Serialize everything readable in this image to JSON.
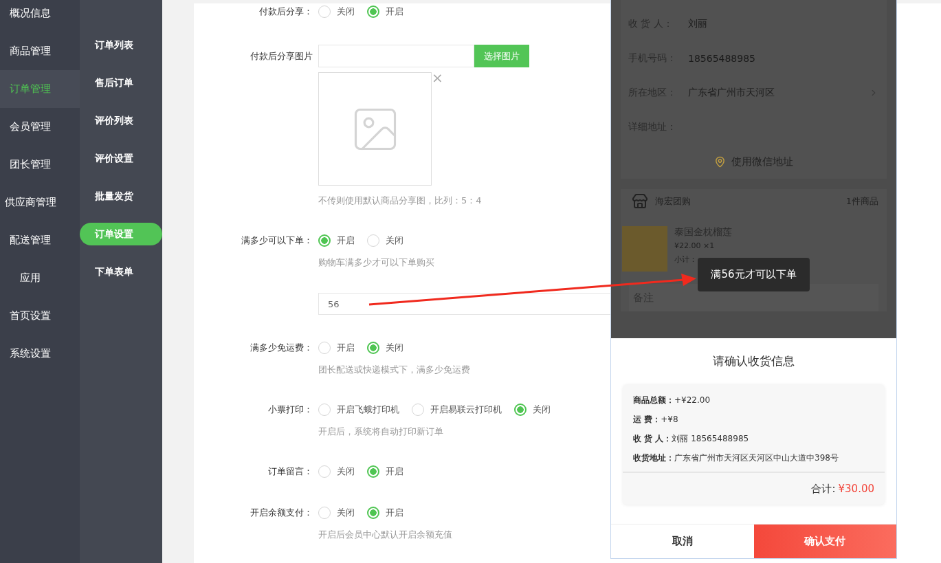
{
  "nav": {
    "items": [
      {
        "label": "概况信息",
        "selected": false
      },
      {
        "label": "商品管理",
        "selected": false
      },
      {
        "label": "订单管理",
        "selected": true
      },
      {
        "label": "会员管理",
        "selected": false
      },
      {
        "label": "团长管理",
        "selected": false
      },
      {
        "label": "供应商管理",
        "selected": false
      },
      {
        "label": "配送管理",
        "selected": false
      },
      {
        "label": "应用",
        "selected": false
      },
      {
        "label": "首页设置",
        "selected": false
      },
      {
        "label": "系统设置",
        "selected": false
      }
    ]
  },
  "subnav": {
    "items": [
      {
        "label": "订单列表",
        "selected": false
      },
      {
        "label": "售后订单",
        "selected": false
      },
      {
        "label": "评价列表",
        "selected": false
      },
      {
        "label": "评价设置",
        "selected": false
      },
      {
        "label": "批量发货",
        "selected": false
      },
      {
        "label": "订单设置",
        "selected": true
      },
      {
        "label": "下单表单",
        "selected": false
      }
    ]
  },
  "form": {
    "fields": [
      {
        "kind": "radio",
        "label": "付款后分享：",
        "options": [
          {
            "label": "关闭",
            "selected": false
          },
          {
            "label": "开启",
            "selected": true
          }
        ]
      },
      {
        "kind": "image",
        "label": "付款后分享图片",
        "button": "选择图片",
        "close": "×",
        "hint": "不传则使用默认商品分享图，比列：5：4"
      },
      {
        "kind": "radio",
        "label": "满多少可以下单：",
        "options": [
          {
            "label": "开启",
            "selected": true
          },
          {
            "label": "关闭",
            "selected": false
          }
        ],
        "hint": "购物车满多少才可以下单购买",
        "input_value": "56"
      },
      {
        "kind": "radio",
        "label": "满多少免运费：",
        "options": [
          {
            "label": "开启",
            "selected": false
          },
          {
            "label": "关闭",
            "selected": true
          }
        ],
        "hint": "团长配送或快递模式下，满多少免运费"
      },
      {
        "kind": "radio",
        "label": "小票打印：",
        "options": [
          {
            "label": "开启飞蛾打印机",
            "selected": false
          },
          {
            "label": "开启易联云打印机",
            "selected": false
          },
          {
            "label": "关闭",
            "selected": true
          }
        ],
        "hint": "开启后，系统将自动打印新订单"
      },
      {
        "kind": "radio",
        "label": "订单留言：",
        "options": [
          {
            "label": "关闭",
            "selected": false
          },
          {
            "label": "开启",
            "selected": true
          }
        ]
      },
      {
        "kind": "radio",
        "label": "开启余额支付：",
        "options": [
          {
            "label": "关闭",
            "selected": false
          },
          {
            "label": "开启",
            "selected": true
          }
        ],
        "hint": "开启后会员中心默认开启余额充值"
      }
    ]
  },
  "phone": {
    "address": {
      "rows": [
        {
          "kind": "text",
          "label": "收 货 人：",
          "value": "刘丽"
        },
        {
          "kind": "text",
          "label": "手机号码：",
          "value": "18565488985"
        },
        {
          "kind": "select",
          "label": "所在地区：",
          "value": "广东省广州市天河区"
        },
        {
          "kind": "text",
          "label": "详细地址："
        }
      ],
      "wechat_button": "使用微信地址"
    },
    "store": {
      "name": "海宏团购",
      "count": "1件商品",
      "product": {
        "name": "泰国金枕榴莲",
        "price": "¥22.00 ×1",
        "subtotal_label": "小计："
      },
      "note_placeholder": "备注"
    },
    "toast": "满56元才可以下单",
    "sheet": {
      "title": "请确认收货信息",
      "lines": [
        {
          "label": "商品总额：",
          "value": "+¥22.00"
        },
        {
          "label": "运 费：",
          "value": "+¥8"
        },
        {
          "label": "收 货 人：",
          "value": "刘丽 18565488985"
        },
        {
          "label": "收货地址：",
          "value": "广东省广州市天河区天河区中山大道中398号"
        }
      ],
      "total_label": "合计:",
      "total_value": "¥30.00",
      "cancel": "取消",
      "confirm": "确认支付"
    }
  }
}
